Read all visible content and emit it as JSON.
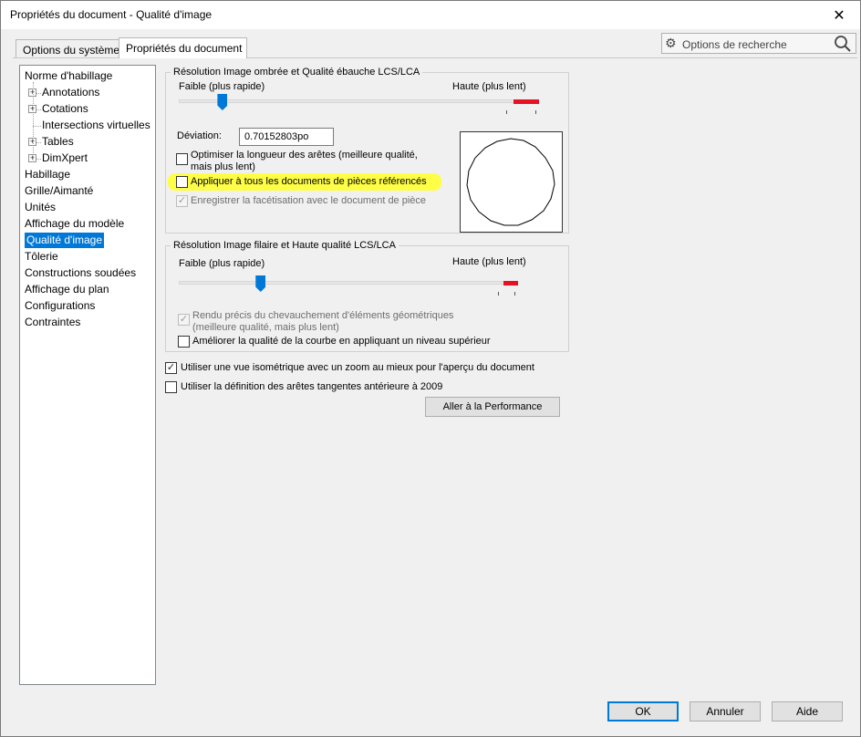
{
  "window": {
    "title": "Propriétés du document - Qualité d'image",
    "close_glyph": "✕"
  },
  "tabs": [
    {
      "label": "Options du système",
      "active": false
    },
    {
      "label": "Propriétés du document",
      "active": true
    }
  ],
  "search": {
    "label": "Options de recherche",
    "icon": "gear-icon",
    "button_icon": "magnifier-icon"
  },
  "tree": {
    "items": [
      {
        "label": "Norme d'habillage",
        "level": 0,
        "expandable": false
      },
      {
        "label": "Annotations",
        "level": 1,
        "expandable": true
      },
      {
        "label": "Cotations",
        "level": 1,
        "expandable": true
      },
      {
        "label": "Intersections virtuelles",
        "level": 1,
        "expandable": false
      },
      {
        "label": "Tables",
        "level": 1,
        "expandable": true
      },
      {
        "label": "DimXpert",
        "level": 1,
        "expandable": true
      },
      {
        "label": "Habillage",
        "level": 0,
        "expandable": false
      },
      {
        "label": "Grille/Aimanté",
        "level": 0,
        "expandable": false
      },
      {
        "label": "Unités",
        "level": 0,
        "expandable": false
      },
      {
        "label": "Affichage du modèle",
        "level": 0,
        "expandable": false
      },
      {
        "label": "Qualité d'image",
        "level": 0,
        "expandable": false,
        "selected": true
      },
      {
        "label": "Tôlerie",
        "level": 0,
        "expandable": false
      },
      {
        "label": "Constructions soudées",
        "level": 0,
        "expandable": false
      },
      {
        "label": "Affichage du plan",
        "level": 0,
        "expandable": false
      },
      {
        "label": "Configurations",
        "level": 0,
        "expandable": false
      },
      {
        "label": "Contraintes",
        "level": 0,
        "expandable": false
      }
    ],
    "expander_glyph": "+"
  },
  "shaded": {
    "legend": "Résolution Image ombrée et Qualité ébauche LCS/LCA",
    "low_label": "Faible (plus rapide)",
    "high_label": "Haute (plus lent)",
    "slider_level": 0.12,
    "deviation_label": "Déviation:",
    "deviation_value": "0.70152803po",
    "optimize_label_1": "Optimiser la longueur des arêtes (meilleure qualité,",
    "optimize_label_2": "mais plus lent)",
    "optimize_checked": false,
    "apply_all_label": "Appliquer à tous les documents de pièces référencés",
    "apply_all_checked": false,
    "save_tess_label": "Enregistrer la facétisation avec le document de pièce",
    "save_tess_checked": true,
    "save_tess_disabled": true
  },
  "wireframe": {
    "legend": "Résolution Image filaire et Haute qualité LCS/LCA",
    "low_label": "Faible (plus rapide)",
    "high_label": "Haute (plus lent)",
    "slider_level": 0.24,
    "precise_label_1": "Rendu précis du chevauchement d'éléments géométriques",
    "precise_label_2": "(meilleure qualité, mais plus lent)",
    "precise_checked": true,
    "precise_disabled": true,
    "improve_label": "Améliorer la qualité de la courbe en appliquant un niveau supérieur",
    "improve_checked": false
  },
  "options": {
    "iso_label": "Utiliser une vue isométrique avec un zoom au mieux pour l'aperçu du document",
    "iso_checked": true,
    "tangent_label": "Utiliser la définition des arêtes tangentes antérieure à 2009",
    "tangent_checked": false,
    "performance_button": "Aller à la Performance"
  },
  "footer": {
    "ok": "OK",
    "cancel": "Annuler",
    "help": "Aide"
  },
  "colors": {
    "accent": "#0078d7",
    "high_warning": "#e81123",
    "highlight": "#ffff33"
  },
  "check_glyph": "✓"
}
